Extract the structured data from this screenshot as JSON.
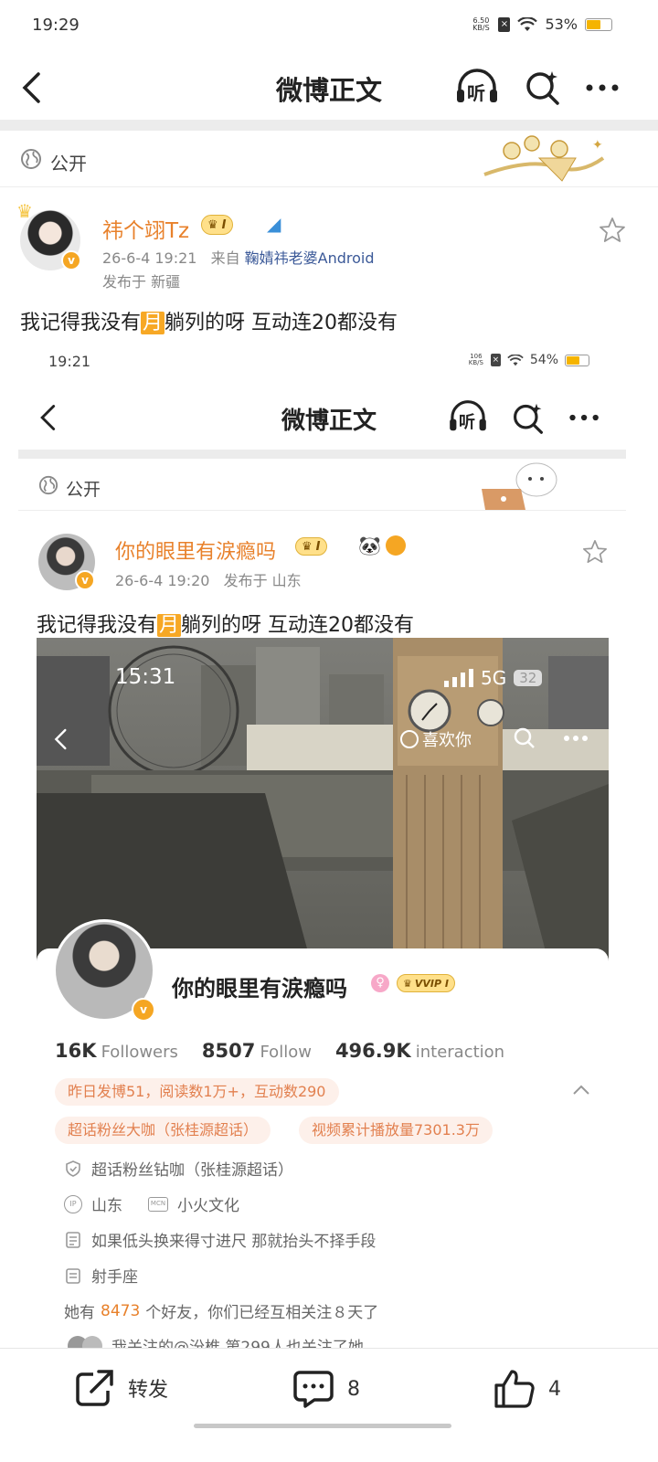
{
  "status": {
    "time": "19:29",
    "net_speed": "6.50 KB/S",
    "battery": "53%",
    "battery_level": 0.53
  },
  "nav": {
    "title": "微博正文",
    "listen_label": "听"
  },
  "post": {
    "visibility": "公开",
    "author": "祎个翊Tz",
    "badge": "I",
    "date": "26-6-4 19:21",
    "from_prefix": "来自",
    "source": "鞠婧祎老婆Android",
    "location": "发布于 新疆",
    "text_before": "我记得我没有",
    "text_highlight": "月",
    "text_after": "躺列的呀 互动连20都没有"
  },
  "screenshot": {
    "status_time": "19:21",
    "net_speed": "106 KB/S",
    "battery": "54%",
    "battery_level": 0.54,
    "nav_title": "微博正文",
    "listen_label": "听",
    "visibility": "公开",
    "author": "你的眼里有涙瘾吗",
    "badge": "I",
    "date": "26-6-4 19:20",
    "location": "发布于 山东",
    "text_before": "我记得我没有",
    "text_highlight": "月",
    "text_after": "躺列的呀 互动连20都没有",
    "inner": {
      "time": "15:31",
      "network": "5G",
      "battery": "32",
      "like_label": "喜欢你"
    },
    "profile": {
      "name": "你的眼里有涙瘾吗",
      "vvip": "VVIP I",
      "followers_num": "16K",
      "followers_lbl": "Followers",
      "follow_num": "8507",
      "follow_lbl": "Follow",
      "interaction_num": "496.9K",
      "interaction_lbl": "interaction",
      "stats_chip": "昨日发博51，阅读数1万+，互动数290",
      "chip_fan": "超话粉丝大咖（张桂源超话）",
      "chip_video": "视频累计播放量7301.3万",
      "row_diamond": "超话粉丝钻咖（张桂源超话）",
      "ip_location": "山东",
      "mcn": "小火文化",
      "bio": "如果低头换来得寸进尺 那就抬头不择手段",
      "zodiac": "射手座",
      "friends_prefix": "她有",
      "friends_count": "8473",
      "friends_suffix": "个好友，你们已经互相关注８天了",
      "mutual": "我关注的@汾椎 第299人也关注了她"
    }
  },
  "actions": {
    "repost": "转发",
    "comments": "8",
    "likes": "4"
  }
}
